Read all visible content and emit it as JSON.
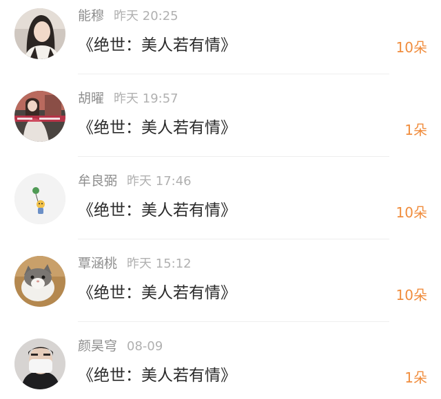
{
  "gift_list": {
    "items": [
      {
        "name": "能穆",
        "time": "昨天 20:25",
        "title": "《绝世：美人若有情》",
        "amount": "10朵",
        "avatar_icon": "woman-portrait-avatar"
      },
      {
        "name": "胡曜",
        "time": "昨天 19:57",
        "title": "《绝世：美人若有情》",
        "amount": "1朵",
        "avatar_icon": "girl-sitting-avatar"
      },
      {
        "name": "牟良弼",
        "time": "昨天 17:46",
        "title": "《绝世：美人若有情》",
        "amount": "10朵",
        "avatar_icon": "cartoon-balloon-avatar"
      },
      {
        "name": "覃涵桃",
        "time": "昨天 15:12",
        "title": "《绝世：美人若有情》",
        "amount": "10朵",
        "avatar_icon": "cat-avatar"
      },
      {
        "name": "颜昊穹",
        "time": "08-09",
        "title": "《绝世：美人若有情》",
        "amount": "1朵",
        "avatar_icon": "masked-man-avatar"
      }
    ]
  },
  "colors": {
    "amount": "#f08c3c",
    "name": "#8e8e8e",
    "time": "#b0b0b0",
    "title": "#2a2a2a",
    "divider": "#eeeeee"
  }
}
